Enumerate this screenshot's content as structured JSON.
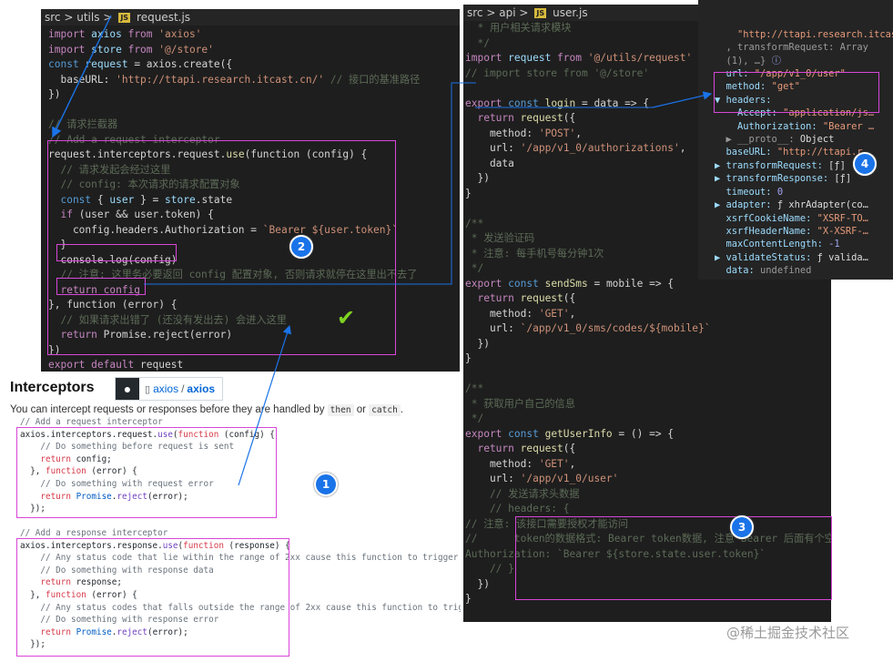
{
  "request_editor": {
    "breadcrumb": {
      "src": "src",
      "folder": "utils",
      "file": "request.js",
      "sep": ">",
      "icon": "JS"
    },
    "lines": [
      [
        [
          "import ",
          "kw"
        ],
        [
          "axios ",
          "var"
        ],
        [
          "from ",
          "kw"
        ],
        [
          "'axios'",
          "str"
        ]
      ],
      [
        [
          "import ",
          "kw"
        ],
        [
          "store ",
          "var"
        ],
        [
          "from ",
          "kw"
        ],
        [
          "'@/store'",
          "str"
        ]
      ],
      [
        [
          "const ",
          "kb"
        ],
        [
          "request ",
          "var"
        ],
        [
          "= ",
          ""
        ],
        [
          "axios",
          ""
        ],
        [
          ".",
          ""
        ],
        [
          "create",
          ""
        ],
        [
          "({",
          ""
        ]
      ],
      [
        [
          "  baseURL: ",
          ""
        ],
        [
          "'http://ttapi.research.itcast.cn/'",
          "str"
        ],
        [
          " // 接口的基准路径",
          "cmd"
        ]
      ],
      [
        [
          "})",
          ""
        ]
      ],
      [
        [
          "",
          ""
        ]
      ],
      [
        [
          "// 请求拦截器",
          "cmd"
        ]
      ],
      [
        [
          "// Add a request interceptor",
          "cmd"
        ]
      ],
      [
        [
          "request",
          ""
        ],
        [
          ".interceptors.request.",
          ""
        ],
        [
          "use",
          "fn"
        ],
        [
          "(function ",
          ""
        ],
        [
          "(config) {",
          ""
        ]
      ],
      [
        [
          "  // 请求发起会经过这里",
          "cmd"
        ]
      ],
      [
        [
          "  // config: 本次请求的请求配置对象",
          "cmd"
        ]
      ],
      [
        [
          "  const ",
          "kb"
        ],
        [
          "{ ",
          ""
        ],
        [
          "user ",
          "var"
        ],
        [
          "} = ",
          ""
        ],
        [
          "store",
          "var"
        ],
        [
          ".state",
          ""
        ]
      ],
      [
        [
          "  if ",
          "kw"
        ],
        [
          "(user && ",
          ""
        ],
        [
          "user",
          ""
        ],
        [
          ".token) {",
          ""
        ]
      ],
      [
        [
          "    config.headers.Authorization = ",
          ""
        ],
        [
          "`Bearer ${user.token}`",
          "str"
        ]
      ],
      [
        [
          "  }",
          ""
        ]
      ],
      [
        [
          "  console.log(config)",
          ""
        ]
      ],
      [
        [
          "  // 注意: 这里务必要返回 config 配置对象, 否则请求就停在这里出不去了",
          "cmd"
        ]
      ],
      [
        [
          "  return config",
          "kw"
        ]
      ],
      [
        [
          "}, ",
          ""
        ],
        [
          "function ",
          ""
        ],
        [
          "(error) {",
          ""
        ]
      ],
      [
        [
          "  // 如果请求出错了 (还没有发出去) 会进入这里",
          "cmd"
        ]
      ],
      [
        [
          "  return ",
          "kw"
        ],
        [
          "Promise",
          ""
        ],
        [
          ".reject(error)",
          ""
        ]
      ],
      [
        [
          "})",
          ""
        ]
      ],
      [
        [
          "export default ",
          "kw"
        ],
        [
          "request",
          ""
        ]
      ]
    ]
  },
  "user_editor": {
    "breadcrumb": {
      "src": "src",
      "folder": "api",
      "file": "user.js",
      "sep": ">",
      "icon": "JS"
    },
    "lines": [
      [
        [
          "  * 用户相关请求模块",
          "cmd"
        ]
      ],
      [
        [
          "  */",
          "cmd"
        ]
      ],
      [
        [
          "import ",
          "kw"
        ],
        [
          "request ",
          "var"
        ],
        [
          "from ",
          "kw"
        ],
        [
          "'@/utils/request'",
          "str"
        ]
      ],
      [
        [
          "// import store from '@/store'",
          "cmd"
        ]
      ],
      [
        [
          "",
          ""
        ]
      ],
      [
        [
          "export ",
          "kw"
        ],
        [
          "const ",
          "kb"
        ],
        [
          "login ",
          "fn"
        ],
        [
          "= data => {",
          ""
        ]
      ],
      [
        [
          "  return ",
          "kw"
        ],
        [
          "request",
          "fn"
        ],
        [
          "({",
          ""
        ]
      ],
      [
        [
          "    method: ",
          ""
        ],
        [
          "'POST'",
          "str"
        ],
        [
          ",",
          ""
        ]
      ],
      [
        [
          "    url: ",
          ""
        ],
        [
          "'/app/v1_0/authorizations'",
          "str"
        ],
        [
          ",",
          ""
        ]
      ],
      [
        [
          "    data",
          ""
        ]
      ],
      [
        [
          "  })",
          ""
        ]
      ],
      [
        [
          "}",
          ""
        ]
      ],
      [
        [
          "",
          ""
        ]
      ],
      [
        [
          "/**",
          "cmd"
        ]
      ],
      [
        [
          " * 发送验证码",
          "cmd"
        ]
      ],
      [
        [
          " * 注意: 每手机号每分钟1次",
          "cmd"
        ]
      ],
      [
        [
          " */",
          "cmd"
        ]
      ],
      [
        [
          "export ",
          "kw"
        ],
        [
          "const ",
          "kb"
        ],
        [
          "sendSms ",
          "fn"
        ],
        [
          "= mobile => {",
          ""
        ]
      ],
      [
        [
          "  return ",
          "kw"
        ],
        [
          "request",
          "fn"
        ],
        [
          "({",
          ""
        ]
      ],
      [
        [
          "    method: ",
          ""
        ],
        [
          "'GET'",
          "str"
        ],
        [
          ",",
          ""
        ]
      ],
      [
        [
          "    url: ",
          ""
        ],
        [
          "`/app/v1_0/sms/codes/${mobile}`",
          "str"
        ]
      ],
      [
        [
          "  })",
          ""
        ]
      ],
      [
        [
          "}",
          ""
        ]
      ],
      [
        [
          "",
          ""
        ]
      ],
      [
        [
          "/**",
          "cmd"
        ]
      ],
      [
        [
          " * 获取用户自己的信息",
          "cmd"
        ]
      ],
      [
        [
          " */",
          "cmd"
        ]
      ],
      [
        [
          "export ",
          "kw"
        ],
        [
          "const ",
          "kb"
        ],
        [
          "getUserInfo ",
          "fn"
        ],
        [
          "= () => {",
          ""
        ]
      ],
      [
        [
          "  return ",
          "kw"
        ],
        [
          "request",
          "fn"
        ],
        [
          "({",
          ""
        ]
      ],
      [
        [
          "    method: ",
          ""
        ],
        [
          "'GET'",
          "str"
        ],
        [
          ",",
          ""
        ]
      ],
      [
        [
          "    url: ",
          ""
        ],
        [
          "'/app/v1_0/user'",
          "str"
        ]
      ],
      [
        [
          "    // 发送请求头数据",
          "cmd"
        ]
      ],
      [
        [
          "    // headers: {",
          "cmd"
        ]
      ],
      [
        [
          "// 注意: 该接口需要授权才能访问",
          "cmd"
        ]
      ],
      [
        [
          "//      token的数据格式: Bearer token数据, 注意 Bearer 后面有个空格",
          "cmd"
        ]
      ],
      [
        [
          "Authorization: `Bearer ${store.state.user.token}`",
          "cmd"
        ]
      ],
      [
        [
          "    // }",
          "cmd"
        ]
      ],
      [
        [
          "  })",
          ""
        ]
      ],
      [
        [
          "}",
          ""
        ]
      ]
    ]
  },
  "console": {
    "lines": [
      [
        [
          "    \"http://ttapi.research.itcast.c",
          "s"
        ]
      ],
      [
        [
          "  , transformRequest: Array",
          "g"
        ]
      ],
      [
        [
          "  (1), …} ",
          "g"
        ],
        [
          "ⓘ",
          "n"
        ]
      ],
      [
        [
          "  url: ",
          "k"
        ],
        [
          "\"/app/v1_0/user\"",
          "s"
        ]
      ],
      [
        [
          "  method: ",
          "k"
        ],
        [
          "\"get\"",
          "s"
        ]
      ],
      [
        [
          "▼ headers:",
          "k"
        ]
      ],
      [
        [
          "    Accept: ",
          "k"
        ],
        [
          "\"application/js…",
          "s"
        ]
      ],
      [
        [
          "    Authorization: ",
          "k"
        ],
        [
          "\"Bearer …",
          "s"
        ]
      ],
      [
        [
          "  ▶ __proto__: ",
          "g"
        ],
        [
          "Object",
          ""
        ]
      ],
      [
        [
          "  baseURL: ",
          "k"
        ],
        [
          "\"http://ttapi.r…",
          "s"
        ]
      ],
      [
        [
          "▶ transformRequest: ",
          "k"
        ],
        [
          "[ƒ]",
          ""
        ]
      ],
      [
        [
          "▶ transformResponse: ",
          "k"
        ],
        [
          "[ƒ]",
          ""
        ]
      ],
      [
        [
          "  timeout: ",
          "k"
        ],
        [
          "0",
          "n"
        ]
      ],
      [
        [
          "▶ adapter: ",
          "k"
        ],
        [
          "ƒ xhrAdapter(co…",
          ""
        ]
      ],
      [
        [
          "  xsrfCookieName: ",
          "k"
        ],
        [
          "\"XSRF-TO…",
          "s"
        ]
      ],
      [
        [
          "  xsrfHeaderName: ",
          "k"
        ],
        [
          "\"X-XSRF-…",
          "s"
        ]
      ],
      [
        [
          "  maxContentLength: ",
          "k"
        ],
        [
          "-1",
          "n"
        ]
      ],
      [
        [
          "▶ validateStatus: ",
          "k"
        ],
        [
          "ƒ valida…",
          ""
        ]
      ],
      [
        [
          "  data: ",
          "k"
        ],
        [
          "undefined",
          "g"
        ]
      ],
      [
        [
          "▶ __proto__: ",
          "g"
        ],
        [
          "Object",
          ""
        ]
      ]
    ]
  },
  "docs": {
    "heading": "Interceptors",
    "repo_owner": "axios",
    "repo_sep": "/",
    "repo_name": "axios",
    "intro": "You can intercept requests or responses before they are handled by",
    "then_code": "then",
    "or_text": "or",
    "catch_code": "catch",
    "period": ".",
    "request_lines": [
      [
        [
          "// Add a request interceptor",
          "cm"
        ]
      ],
      [
        [
          "axios.interceptors.request.",
          ""
        ],
        [
          "use",
          "fn"
        ],
        [
          "(",
          ""
        ],
        [
          "function ",
          "kw"
        ],
        [
          "(config) {",
          ""
        ]
      ],
      [
        [
          "    // Do something before request is sent",
          "cm"
        ]
      ],
      [
        [
          "    ",
          ""
        ],
        [
          "return ",
          "kw"
        ],
        [
          "config;",
          ""
        ]
      ],
      [
        [
          "  }, ",
          ""
        ],
        [
          "function ",
          "kw"
        ],
        [
          "(error) {",
          ""
        ]
      ],
      [
        [
          "    // Do something with request error",
          "cm"
        ]
      ],
      [
        [
          "    ",
          ""
        ],
        [
          "return ",
          "kw"
        ],
        [
          "Promise",
          "cls"
        ],
        [
          ".",
          ""
        ],
        [
          "reject",
          "fn"
        ],
        [
          "(error);",
          ""
        ]
      ],
      [
        [
          "  });",
          ""
        ]
      ]
    ],
    "response_lines": [
      [
        [
          "// Add a response interceptor",
          "cm"
        ]
      ],
      [
        [
          "axios.interceptors.response.",
          ""
        ],
        [
          "use",
          "fn"
        ],
        [
          "(",
          ""
        ],
        [
          "function ",
          "kw"
        ],
        [
          "(response) {",
          ""
        ]
      ],
      [
        [
          "    // Any status code that lie within the range of 2xx cause this function to trigger",
          "cm"
        ]
      ],
      [
        [
          "    // Do something with response data",
          "cm"
        ]
      ],
      [
        [
          "    ",
          ""
        ],
        [
          "return ",
          "kw"
        ],
        [
          "response;",
          ""
        ]
      ],
      [
        [
          "  }, ",
          ""
        ],
        [
          "function ",
          "kw"
        ],
        [
          "(error) {",
          ""
        ]
      ],
      [
        [
          "    // Any status codes that falls outside the range of 2xx cause this function to trigger",
          "cm"
        ]
      ],
      [
        [
          "    // Do something with response error",
          "cm"
        ]
      ],
      [
        [
          "    ",
          ""
        ],
        [
          "return ",
          "kw"
        ],
        [
          "Promise",
          "cls"
        ],
        [
          ".",
          ""
        ],
        [
          "reject",
          "fn"
        ],
        [
          "(error);",
          ""
        ]
      ],
      [
        [
          "  });",
          ""
        ]
      ]
    ]
  },
  "badges": [
    "1",
    "2",
    "3",
    "4"
  ],
  "check_mark": "✔",
  "watermark": "@稀土掘金技术社区",
  "colors": {
    "highlight": "#d946d9",
    "arrow": "#1a73e8",
    "badge": "#1a73e8",
    "check": "#7ed321"
  }
}
